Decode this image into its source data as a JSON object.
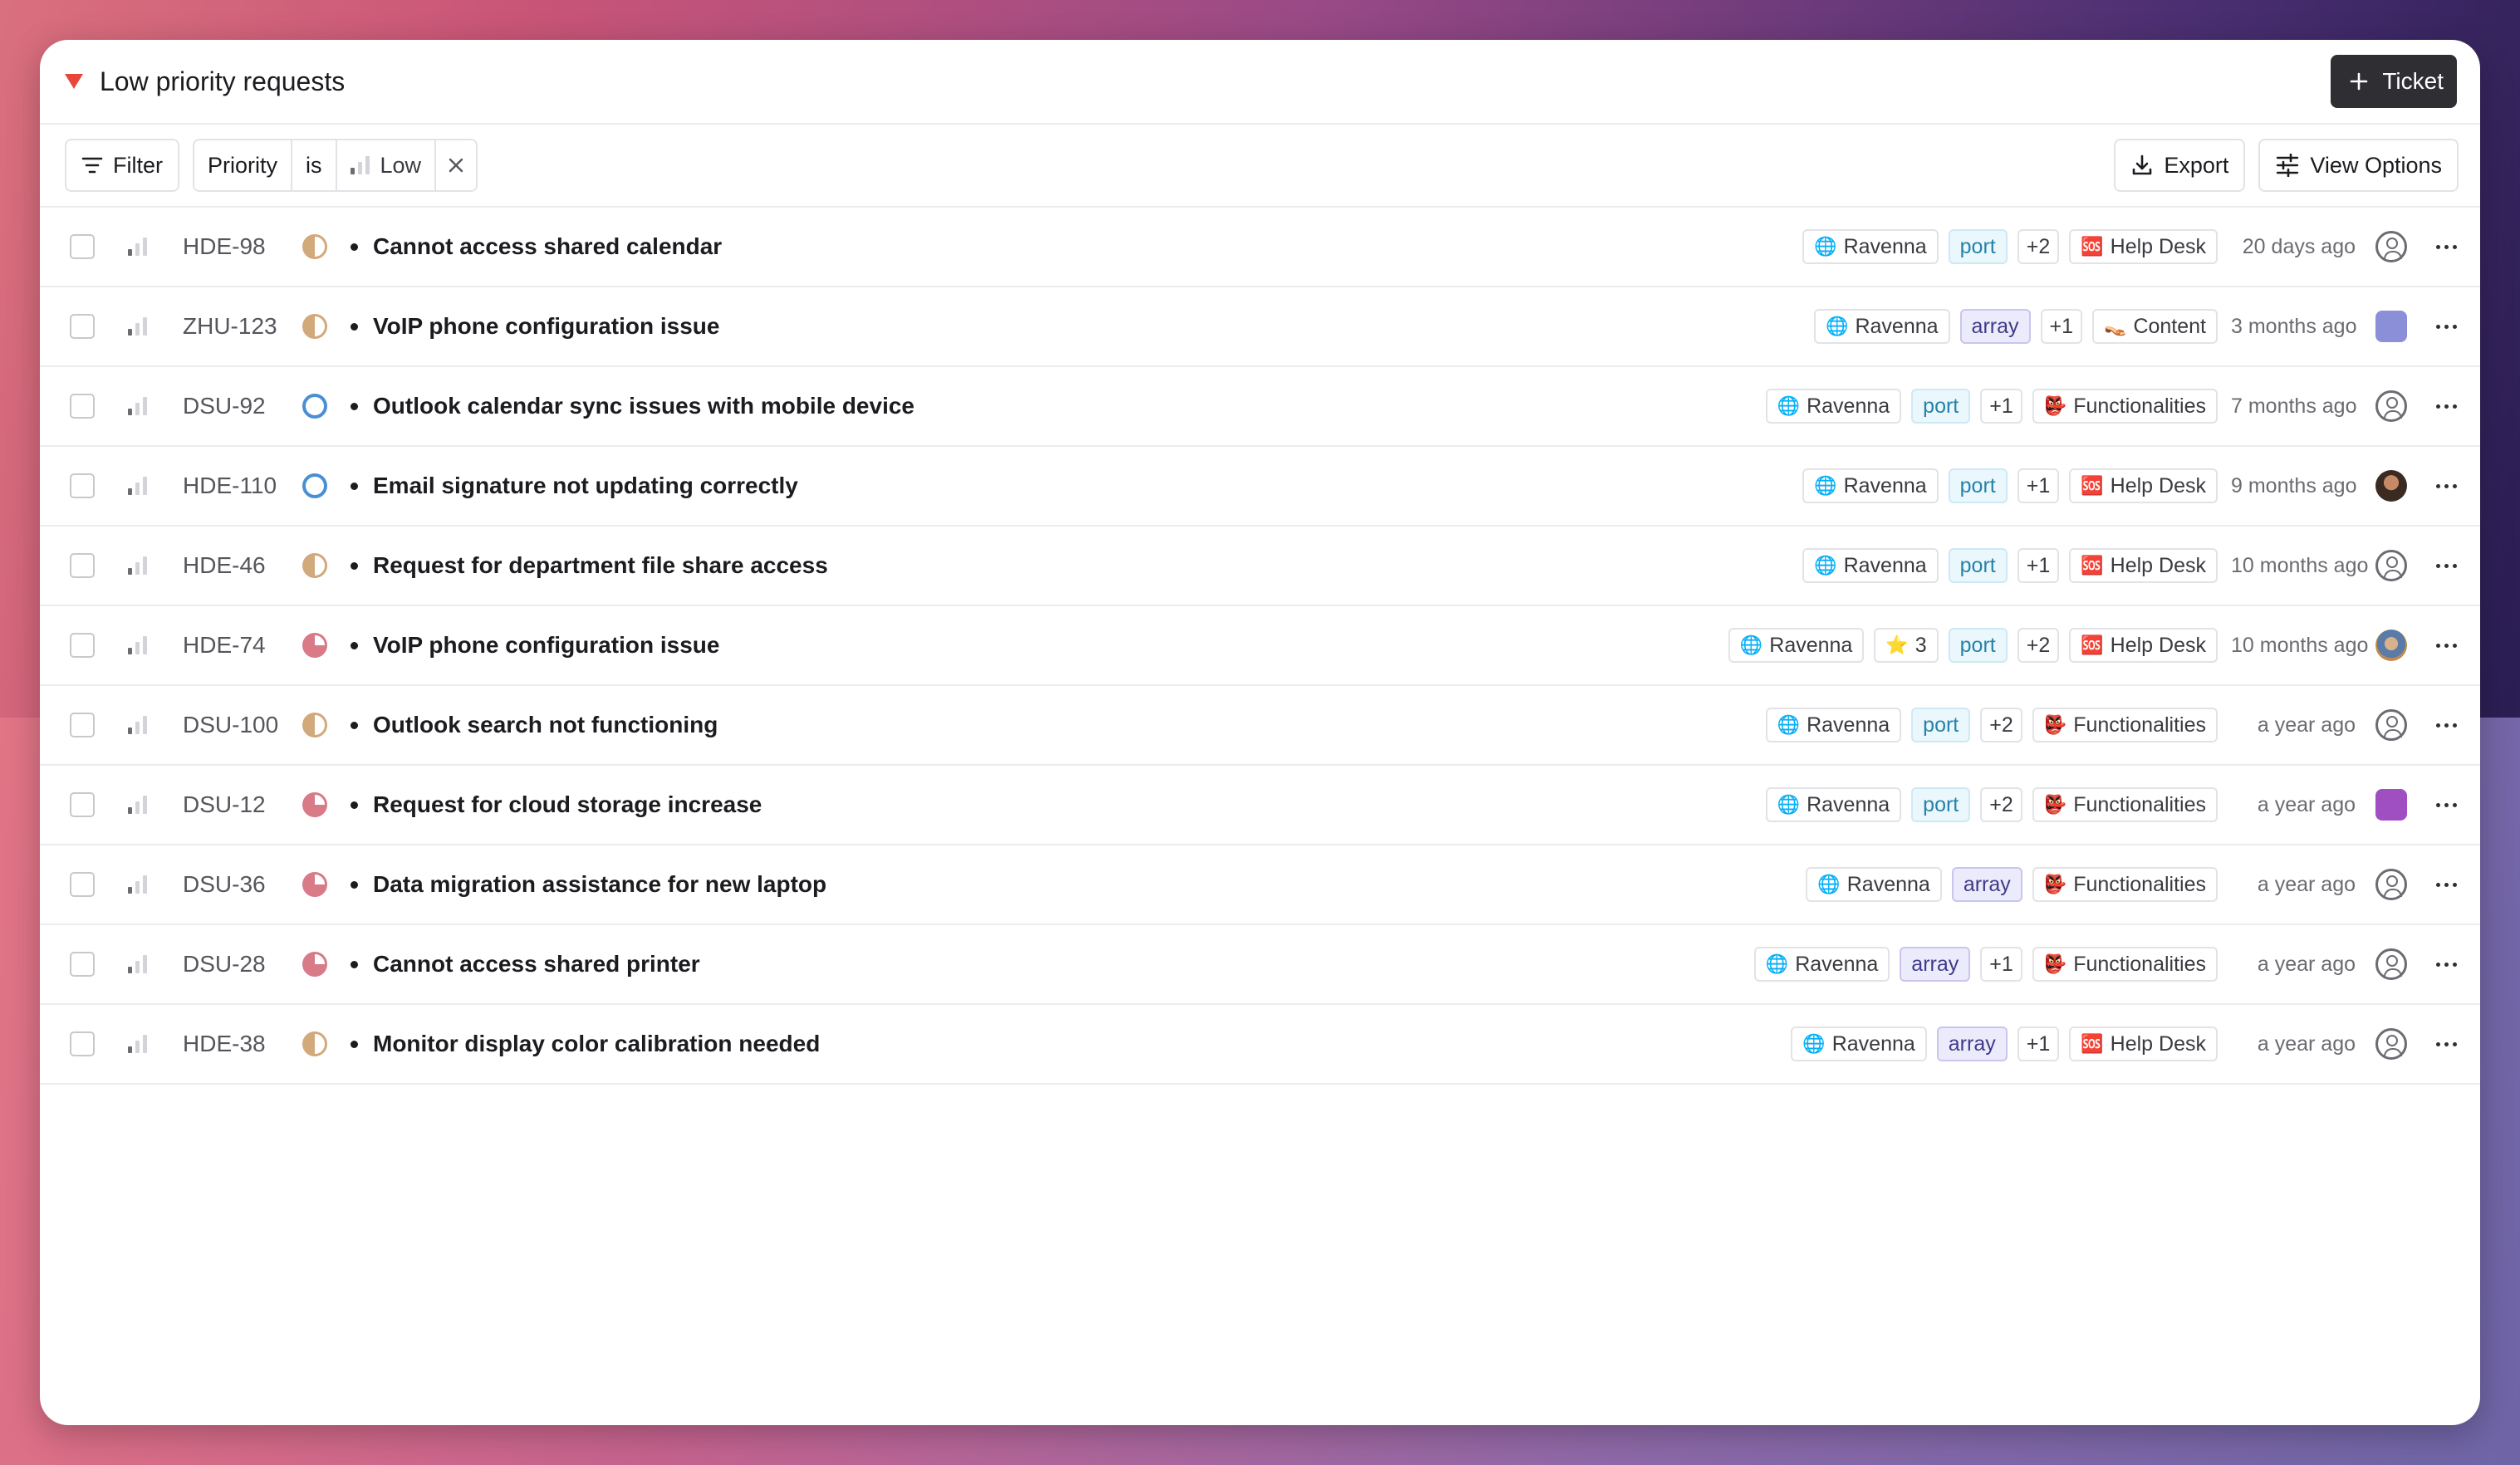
{
  "header": {
    "title": "Low priority requests",
    "new_ticket_label": "Ticket"
  },
  "toolbar": {
    "filter_label": "Filter",
    "filter_field": "Priority",
    "filter_operator": "is",
    "filter_value": "Low",
    "export_label": "Export",
    "view_options_label": "View Options"
  },
  "rows": [
    {
      "id": "HDE-98",
      "status": "in-progress",
      "subject": "Cannot access shared calendar",
      "project": "Ravenna",
      "label": "port",
      "label_kind": "port",
      "star": "",
      "more": "+2",
      "team_icon": "🆘",
      "team": "Help Desk",
      "time": "20 days ago",
      "assignee": "empty"
    },
    {
      "id": "ZHU-123",
      "status": "in-progress",
      "subject": "VoIP phone configuration issue",
      "project": "Ravenna",
      "label": "array",
      "label_kind": "array",
      "star": "",
      "more": "+1",
      "team_icon": "👡",
      "team": "Content",
      "time": "3 months ago",
      "assignee": "pix1"
    },
    {
      "id": "DSU-92",
      "status": "open",
      "subject": "Outlook calendar sync issues with mobile device",
      "project": "Ravenna",
      "label": "port",
      "label_kind": "port",
      "star": "",
      "more": "+1",
      "team_icon": "👺",
      "team": "Functionalities",
      "time": "7 months ago",
      "assignee": "empty"
    },
    {
      "id": "HDE-110",
      "status": "open",
      "subject": "Email signature not updating correctly",
      "project": "Ravenna",
      "label": "port",
      "label_kind": "port",
      "star": "",
      "more": "+1",
      "team_icon": "🆘",
      "team": "Help Desk",
      "time": "9 months ago",
      "assignee": "photo1"
    },
    {
      "id": "HDE-46",
      "status": "in-progress",
      "subject": "Request for department file share access",
      "project": "Ravenna",
      "label": "port",
      "label_kind": "port",
      "star": "",
      "more": "+1",
      "team_icon": "🆘",
      "team": "Help Desk",
      "time": "10 months ago",
      "assignee": "empty"
    },
    {
      "id": "HDE-74",
      "status": "review",
      "subject": "VoIP phone configuration issue",
      "project": "Ravenna",
      "label": "port",
      "label_kind": "port",
      "star": "3",
      "more": "+2",
      "team_icon": "🆘",
      "team": "Help Desk",
      "time": "10 months ago",
      "assignee": "photo2"
    },
    {
      "id": "DSU-100",
      "status": "in-progress",
      "subject": "Outlook search not functioning",
      "project": "Ravenna",
      "label": "port",
      "label_kind": "port",
      "star": "",
      "more": "+2",
      "team_icon": "👺",
      "team": "Functionalities",
      "time": "a year ago",
      "assignee": "empty"
    },
    {
      "id": "DSU-12",
      "status": "review",
      "subject": "Request for cloud storage increase",
      "project": "Ravenna",
      "label": "port",
      "label_kind": "port",
      "star": "",
      "more": "+2",
      "team_icon": "👺",
      "team": "Functionalities",
      "time": "a year ago",
      "assignee": "pix2"
    },
    {
      "id": "DSU-36",
      "status": "review",
      "subject": "Data migration assistance for new laptop",
      "project": "Ravenna",
      "label": "array",
      "label_kind": "array",
      "star": "",
      "more": "",
      "team_icon": "👺",
      "team": "Functionalities",
      "time": "a year ago",
      "assignee": "empty"
    },
    {
      "id": "DSU-28",
      "status": "review",
      "subject": "Cannot access shared printer",
      "project": "Ravenna",
      "label": "array",
      "label_kind": "array",
      "star": "",
      "more": "+1",
      "team_icon": "👺",
      "team": "Functionalities",
      "time": "a year ago",
      "assignee": "empty"
    },
    {
      "id": "HDE-38",
      "status": "in-progress",
      "subject": "Monitor display color calibration needed",
      "project": "Ravenna",
      "label": "array",
      "label_kind": "array",
      "star": "",
      "more": "+1",
      "team_icon": "🆘",
      "team": "Help Desk",
      "time": "a year ago",
      "assignee": "empty"
    }
  ]
}
